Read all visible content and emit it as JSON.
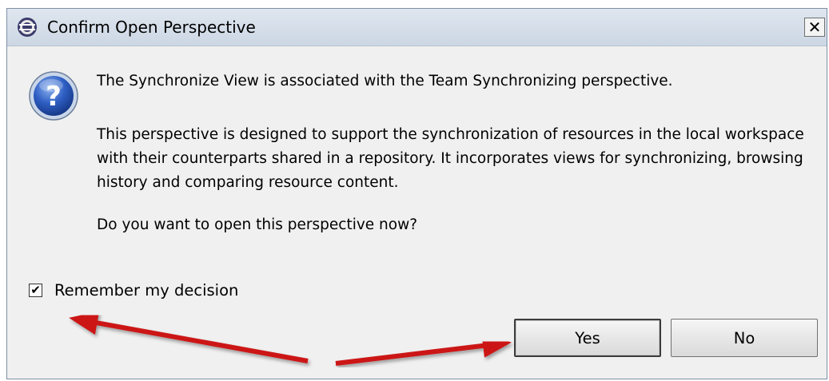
{
  "window": {
    "title": "Confirm Open Perspective",
    "close_glyph": "✕"
  },
  "icons": {
    "title": "eclipse-icon",
    "message": "question-icon"
  },
  "message": {
    "line1": "The Synchronize View is associated with the Team Synchronizing perspective.",
    "line2": "This perspective is designed to support the synchronization of resources in the local workspace with their counterparts shared in a repository. It incorporates views for synchronizing, browsing history and comparing resource content.",
    "line3": "Do you want to open this perspective now?"
  },
  "remember": {
    "label": "Remember my decision",
    "checked": true,
    "check_glyph": "✔"
  },
  "buttons": {
    "yes": "Yes",
    "no": "No"
  },
  "annotation": {
    "arrow_color": "#cc1414",
    "arrows": [
      "points-to-remember-checkbox",
      "points-to-yes-button"
    ]
  }
}
